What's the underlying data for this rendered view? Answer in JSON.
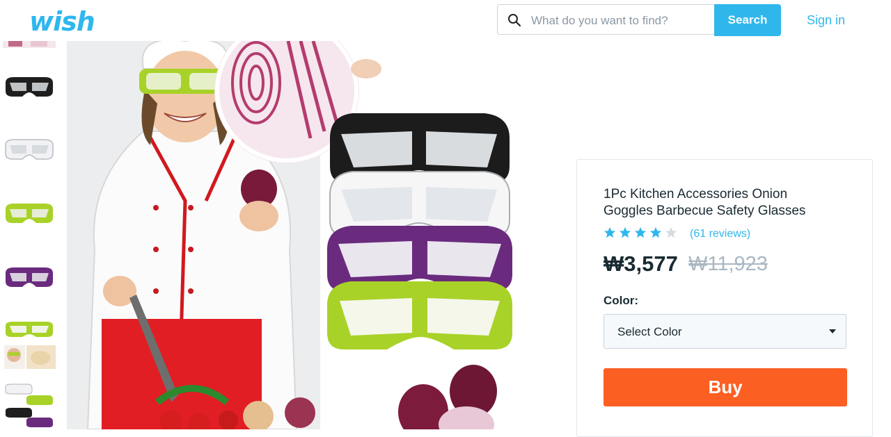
{
  "header": {
    "logo": "wish",
    "search_placeholder": "What do you want to find?",
    "search_button": "Search",
    "sign_in": "Sign in"
  },
  "thumbnails": [
    {
      "icon": "onion-cut-thumbnail"
    },
    {
      "icon": "black-goggles-thumbnail",
      "color": "#1e1e1e"
    },
    {
      "icon": "white-goggles-thumbnail",
      "color": "#f4f4f4"
    },
    {
      "icon": "green-goggles-thumbnail",
      "color": "#a8d228"
    },
    {
      "icon": "purple-goggles-thumbnail",
      "color": "#6a2b7e"
    },
    {
      "icon": "green-goggles-model-thumbnail",
      "color": "#a8d228"
    },
    {
      "icon": "multi-goggles-thumbnail"
    }
  ],
  "product": {
    "title": "1Pc Kitchen Accessories Onion Goggles Barbecue Safety Glasses",
    "rating": 4,
    "rating_max": 5,
    "reviews": "(61 reviews)",
    "price": "₩3,577",
    "old_price": "₩11,923",
    "color_label": "Color:",
    "color_select": "Select Color",
    "buy_button": "Buy"
  },
  "colors": {
    "brand": "#2fb7ec",
    "buy": "#fc5f22",
    "text": "#192a32",
    "muted": "#aab7c2"
  }
}
